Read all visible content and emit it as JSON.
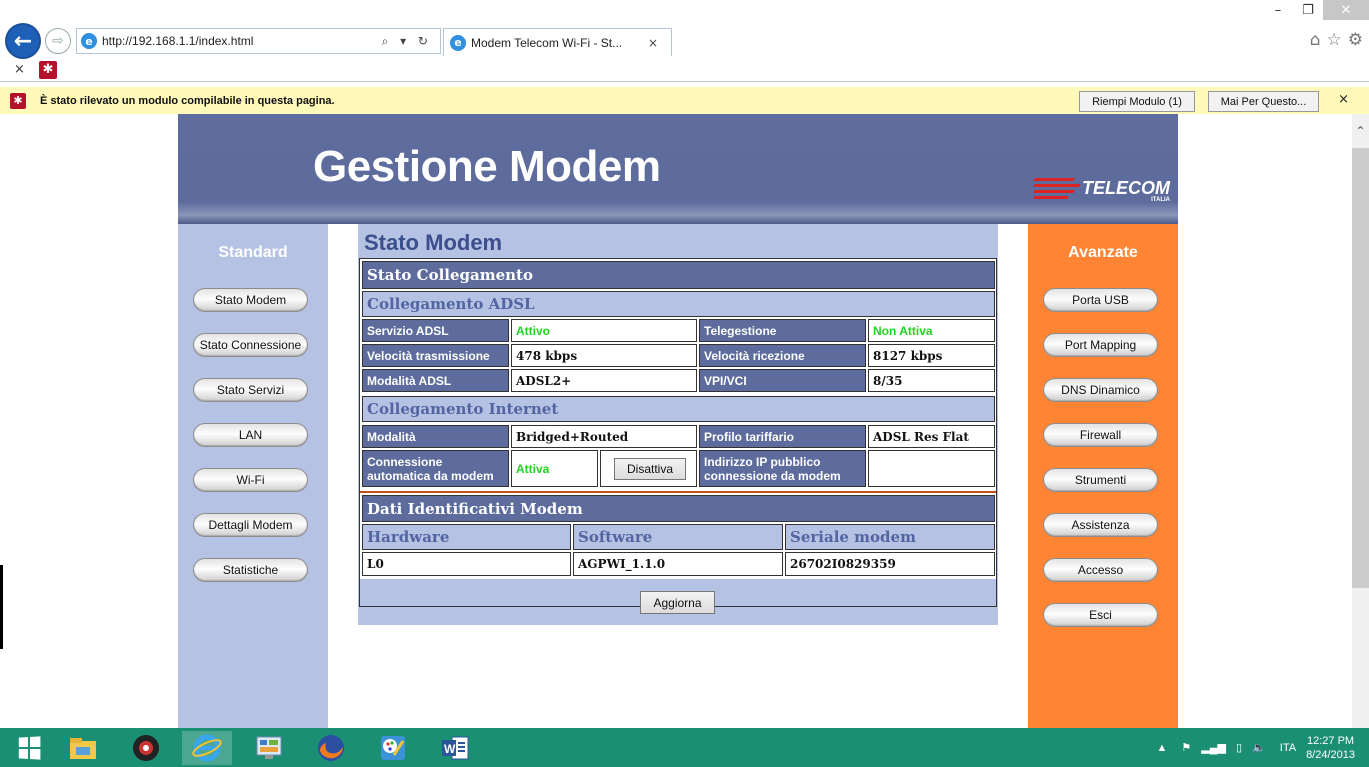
{
  "browser": {
    "url": "http://192.168.1.1/index.html",
    "tab_title": "Modem Telecom Wi-Fi - St...",
    "tab_close": "×",
    "address_tools": "⌕ ▾ ↻",
    "toolbar_close": "×",
    "win_minimize": "–",
    "win_restore": "❐",
    "win_close": "✕"
  },
  "notification": {
    "message": "È stato rilevato un modulo compilabile in questa pagina.",
    "fill_button": "Riempi Modulo (1)",
    "never_button": "Mai Per Questo...",
    "close": "×"
  },
  "header": {
    "title": "Gestione Modem",
    "logo_word": "TELECOM",
    "logo_sub": "ITALIA"
  },
  "left_nav": {
    "title": "Standard",
    "items": [
      "Stato Modem",
      "Stato Connessione",
      "Stato Servizi",
      "LAN",
      "Wi-Fi",
      "Dettagli Modem",
      "Statistiche"
    ]
  },
  "right_nav": {
    "title": "Avanzate",
    "items": [
      "Porta USB",
      "Port Mapping",
      "DNS Dinamico",
      "Firewall",
      "Strumenti",
      "Assistenza",
      "Accesso",
      "Esci"
    ]
  },
  "main": {
    "page_title": "Stato Modem",
    "section_status": "Stato Collegamento",
    "adsl": {
      "header": "Collegamento ADSL",
      "rows": [
        {
          "l1": "Servizio ADSL",
          "v1": "Attivo",
          "l2": "Telegestione",
          "v2": "Non Attiva"
        },
        {
          "l1": "Velocità trasmissione",
          "v1": "478 kbps",
          "l2": "Velocità ricezione",
          "v2": "8127 kbps"
        },
        {
          "l1": "Modalità ADSL",
          "v1": "ADSL2+",
          "l2": "VPI/VCI",
          "v2": "8/35"
        }
      ]
    },
    "internet": {
      "header": "Collegamento Internet",
      "mode_label": "Modalità",
      "mode_value": "Bridged+Routed",
      "profile_label": "Profilo tariffario",
      "profile_value": "ADSL Res Flat",
      "auto_label": "Connessione automatica da modem",
      "auto_value": "Attiva",
      "disable_button": "Disattiva",
      "ip_label": "Indirizzo IP pubblico connessione da modem",
      "ip_value": ""
    },
    "ident": {
      "header": "Dati Identificativi Modem",
      "columns": [
        "Hardware",
        "Software",
        "Seriale modem"
      ],
      "values": [
        "L0",
        "AGPWI_1.1.0",
        "26702I0829359"
      ]
    },
    "refresh_button": "Aggiorna"
  },
  "taskbar": {
    "language": "ITA",
    "time": "12:27 PM",
    "date": "8/24/2013"
  },
  "colors": {
    "header_blue": "#5d6c9c",
    "light_blue": "#b5c2e4",
    "orange": "#ff8433",
    "status_green": "#1fd61f",
    "taskbar": "#1a8f74"
  }
}
